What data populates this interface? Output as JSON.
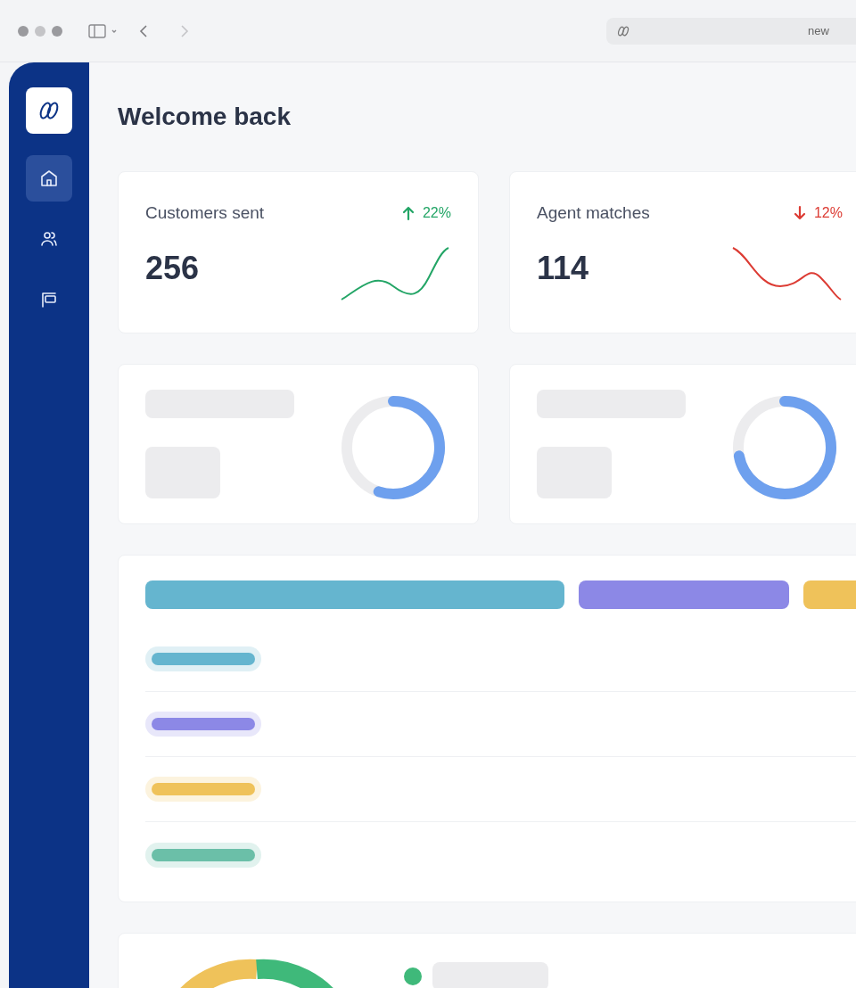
{
  "browser": {
    "address": "new"
  },
  "sidebar": {
    "items": [
      {
        "kind": "home",
        "selected": true
      },
      {
        "kind": "people",
        "selected": false
      },
      {
        "kind": "board",
        "selected": false
      }
    ]
  },
  "page": {
    "title": "Welcome back"
  },
  "stats": [
    {
      "label": "Customers sent",
      "value": "256",
      "change": "22%",
      "kind": "up"
    },
    {
      "label": "Agent matches",
      "value": "114",
      "change": "12%",
      "kind": "down"
    }
  ],
  "distribution": {
    "segments": [
      {
        "color": "#65b5cf"
      },
      {
        "color": "#8c88e6"
      },
      {
        "color": "#efc25a"
      }
    ],
    "rows": [
      {
        "color": "#65b5cf"
      },
      {
        "color": "#8c88e6"
      },
      {
        "color": "#efc25a"
      },
      {
        "color": "#6bbfa8"
      }
    ]
  },
  "breakdown": {
    "legend": [
      {
        "color": "#3fb97a"
      }
    ]
  }
}
